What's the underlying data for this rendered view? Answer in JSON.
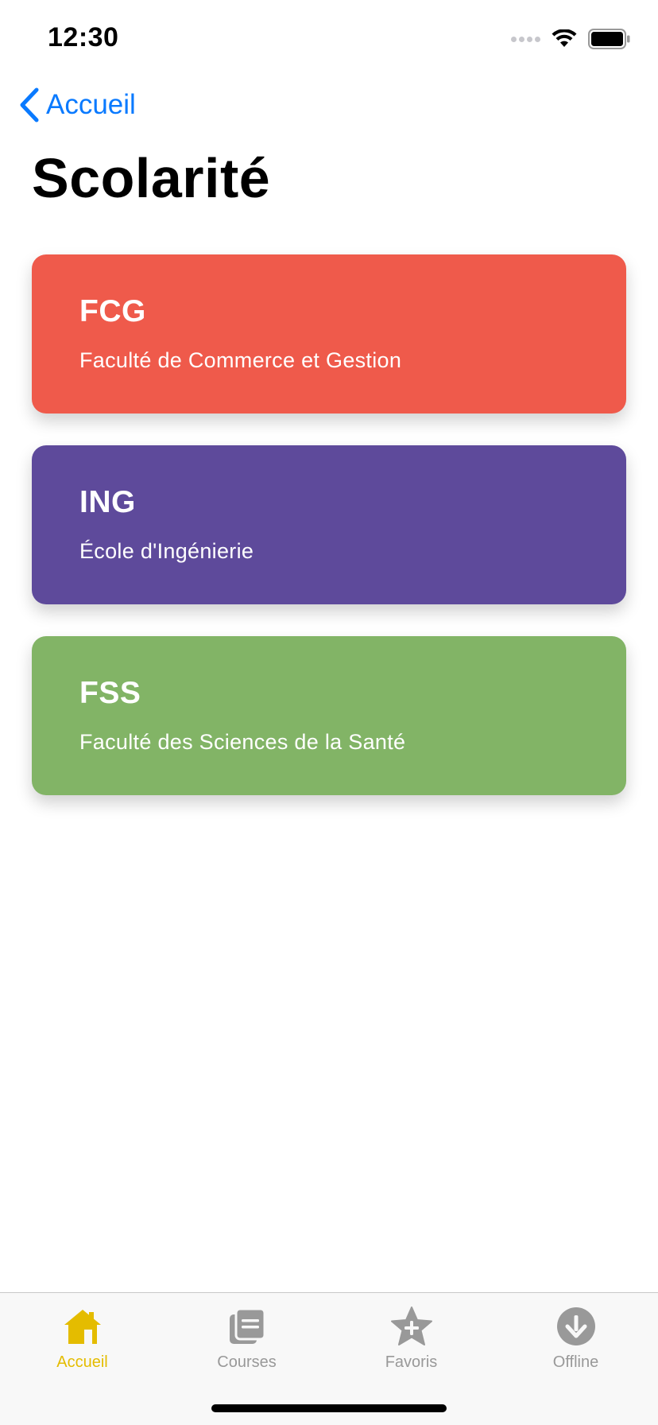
{
  "status_bar": {
    "time": "12:30"
  },
  "nav": {
    "back_label": "Accueil",
    "title": "Scolarité"
  },
  "cards": [
    {
      "code": "FCG",
      "name": "Faculté de Commerce et Gestion",
      "color": "#ef5a4b"
    },
    {
      "code": "ING",
      "name": "École d'Ingénierie",
      "color": "#5e4a9b"
    },
    {
      "code": "FSS",
      "name": "Faculté des Sciences de la Santé",
      "color": "#82b466"
    }
  ],
  "tab_bar": {
    "active_color": "#e4bc00",
    "inactive_color": "#999999",
    "tabs": [
      {
        "label": "Accueil",
        "icon": "home-icon",
        "active": true
      },
      {
        "label": "Courses",
        "icon": "courses-icon",
        "active": false
      },
      {
        "label": "Favoris",
        "icon": "star-plus-icon",
        "active": false
      },
      {
        "label": "Offline",
        "icon": "download-icon",
        "active": false
      }
    ]
  }
}
